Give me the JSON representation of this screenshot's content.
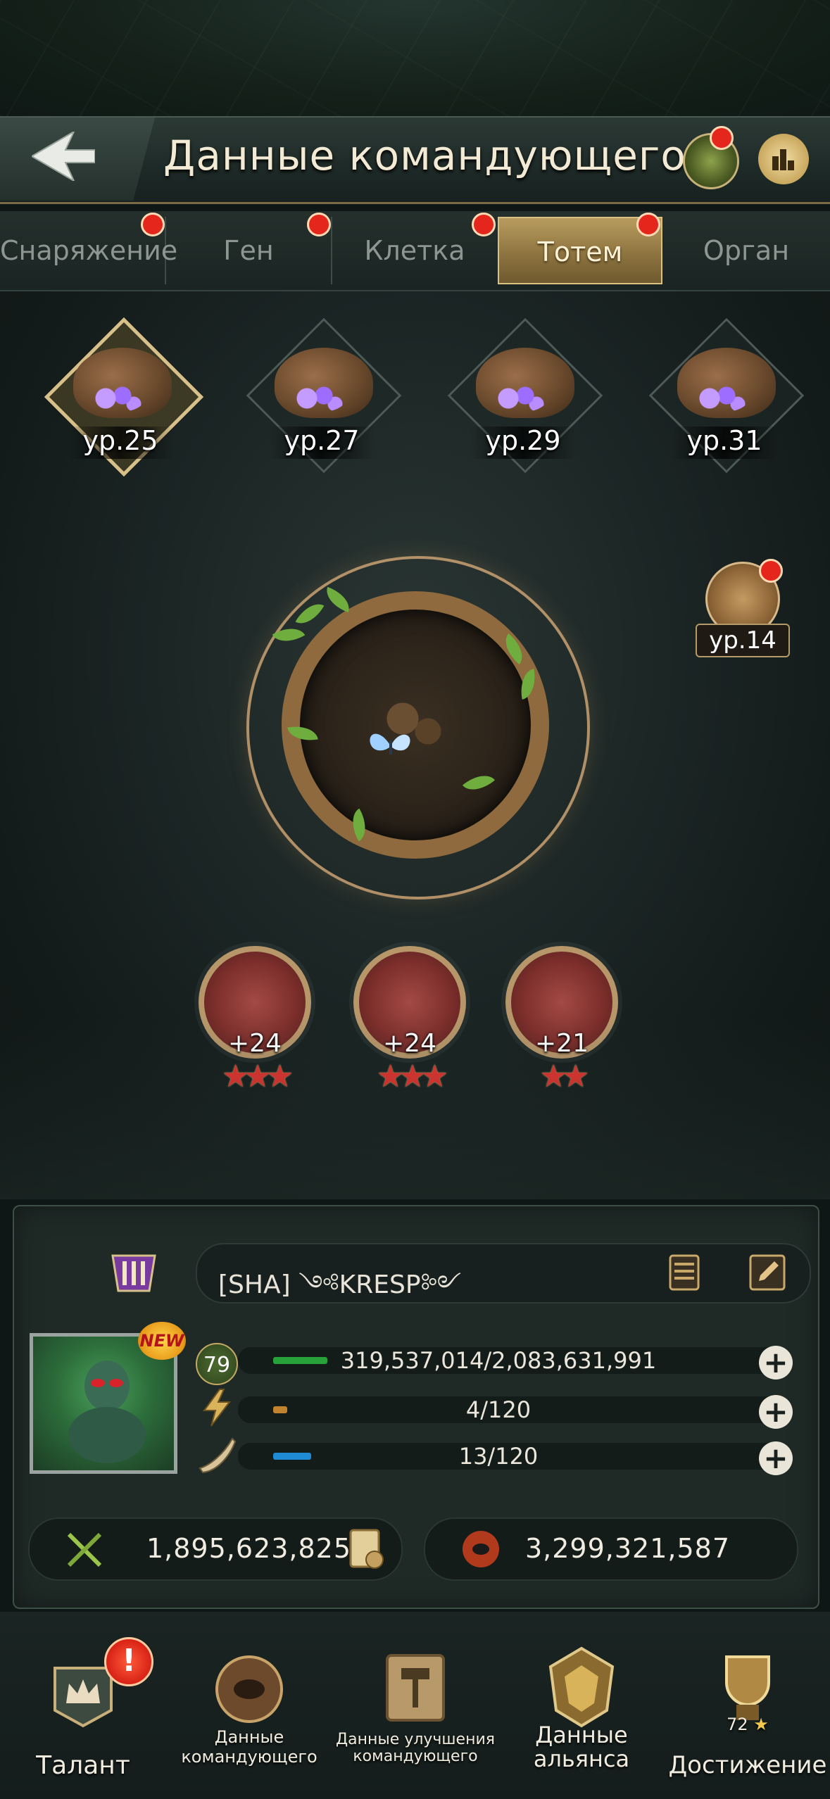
{
  "header": {
    "title": "Данные командующего"
  },
  "tabs": [
    {
      "label": "Снаряжение",
      "active": false,
      "badge": true
    },
    {
      "label": "Ген",
      "active": false,
      "badge": true
    },
    {
      "label": "Клетка",
      "active": false,
      "badge": true
    },
    {
      "label": "Тотем",
      "active": true,
      "badge": true
    },
    {
      "label": "Орган",
      "active": false,
      "badge": false
    }
  ],
  "totems": [
    {
      "level": "ур.25",
      "selected": true
    },
    {
      "level": "ур.27",
      "selected": false
    },
    {
      "level": "ур.29",
      "selected": false
    },
    {
      "level": "ур.31",
      "selected": false
    }
  ],
  "upgrade_totem": {
    "level": "ур.14"
  },
  "stat_badges": [
    {
      "bonus": "+24",
      "stars": 3
    },
    {
      "bonus": "+24",
      "stars": 3
    },
    {
      "bonus": "+21",
      "stars": 2
    }
  ],
  "player": {
    "name": "[SHA]  ༺KRESP༻",
    "level": "79",
    "resources": [
      {
        "icon": "food-icon",
        "value": "319,537,014/2,083,631,991",
        "fraction": 0.153,
        "color": "#27a23a"
      },
      {
        "icon": "lightning-icon",
        "value": "4/120",
        "fraction": 0.033,
        "color": "#c2832f"
      },
      {
        "icon": "horn-icon",
        "value": "13/120",
        "fraction": 0.108,
        "color": "#1f8bd4"
      }
    ],
    "attack_power": "1,895,623,825",
    "kill_power": "3,299,321,587",
    "new_badge": "NEW"
  },
  "nav": [
    {
      "label": "Талант",
      "alert": "!"
    },
    {
      "label": "Данные командующего"
    },
    {
      "label": "Данные улучшения командующего"
    },
    {
      "label": "Данные альянса"
    },
    {
      "label": "Достижение",
      "count": "72"
    }
  ],
  "colors": {
    "accent_gold": "#d8c08a",
    "active_tab": "#8e7440",
    "badge_red": "#e4261c"
  }
}
